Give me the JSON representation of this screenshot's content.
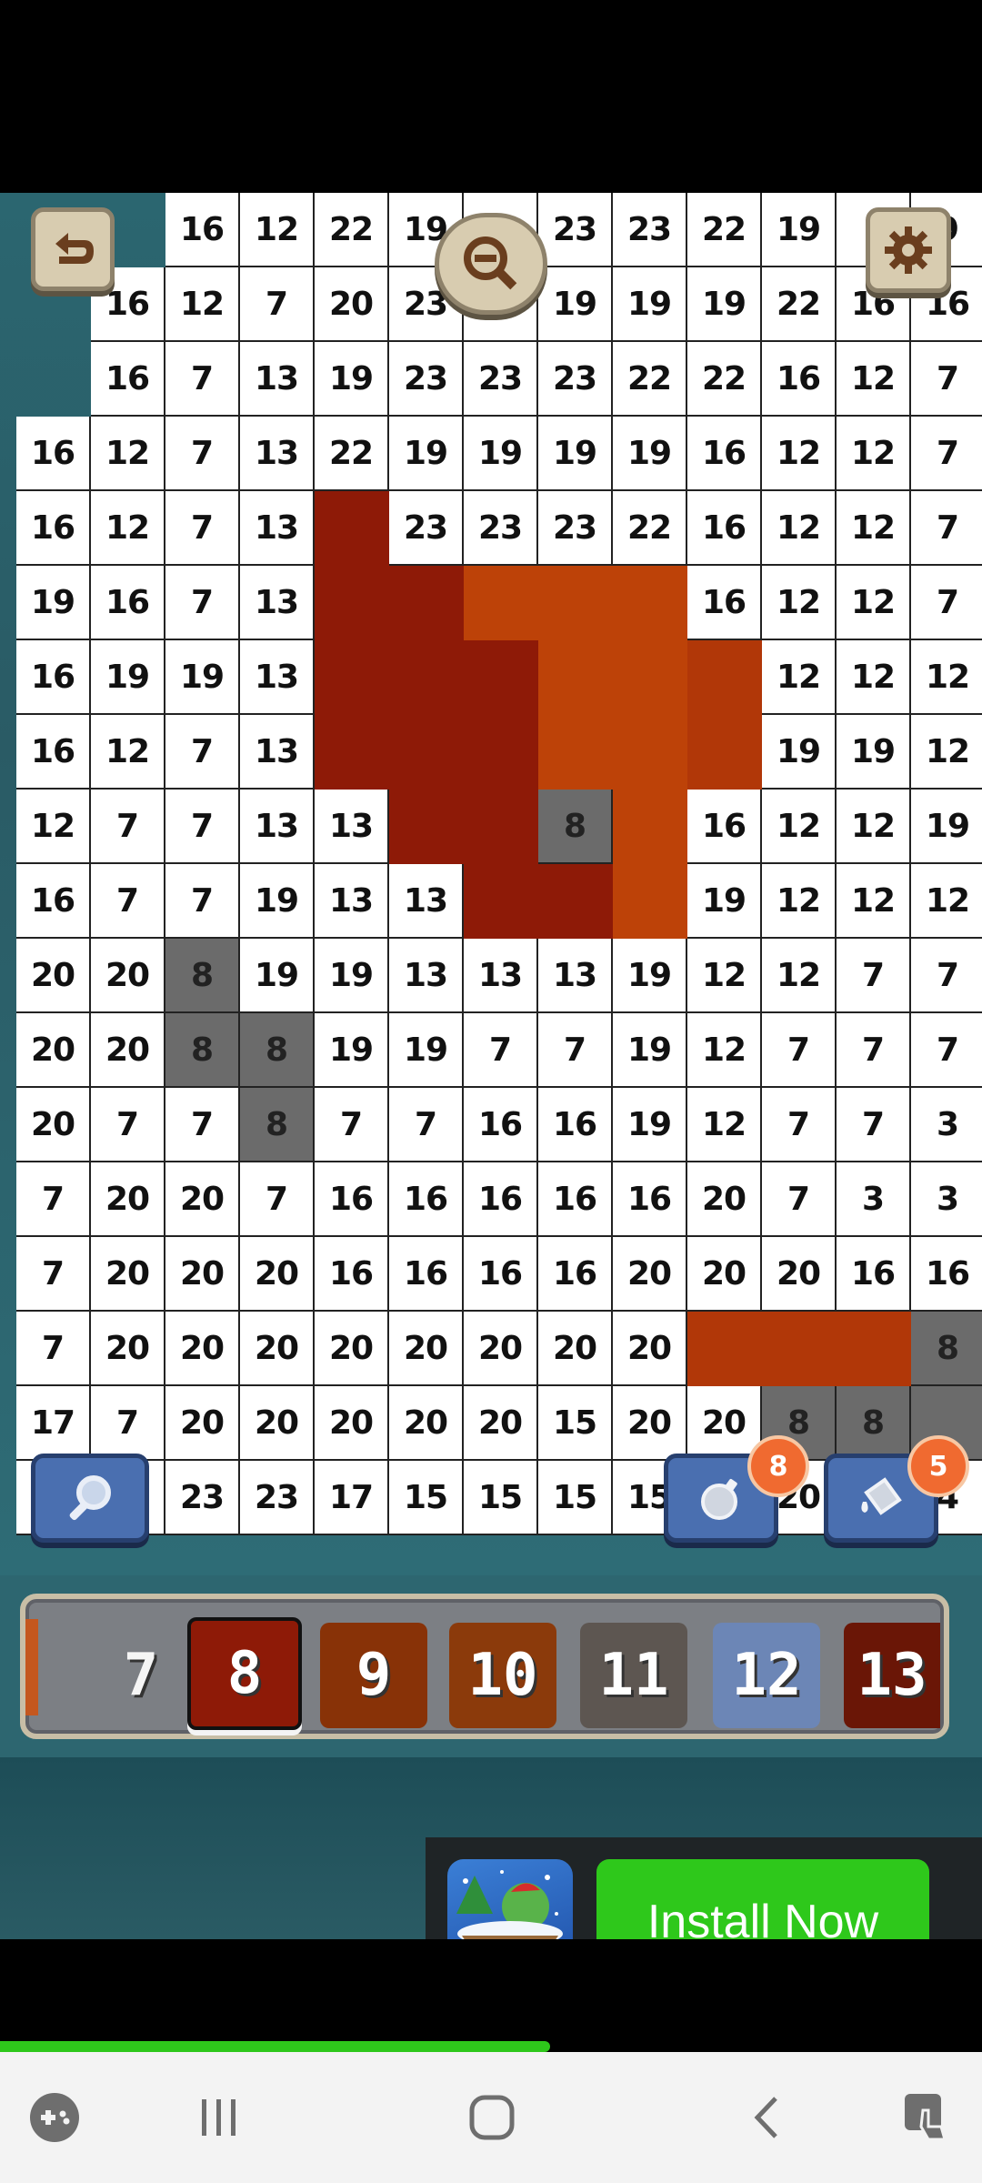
{
  "grid": {
    "rows": [
      [
        "",
        "",
        "16",
        "12",
        "22",
        "19",
        "",
        "23",
        "23",
        "22",
        "19",
        "",
        "9"
      ],
      [
        "",
        "16",
        "12",
        "7",
        "20",
        "23",
        "",
        "19",
        "19",
        "19",
        "22",
        "16",
        "16"
      ],
      [
        "",
        "16",
        "7",
        "13",
        "19",
        "23",
        "23",
        "23",
        "22",
        "22",
        "16",
        "12",
        "7"
      ],
      [
        "16",
        "12",
        "7",
        "13",
        "22",
        "19",
        "19",
        "19",
        "19",
        "16",
        "12",
        "12",
        "7"
      ],
      [
        "16",
        "12",
        "7",
        "13",
        "",
        "23",
        "23",
        "23",
        "22",
        "16",
        "12",
        "12",
        "7"
      ],
      [
        "19",
        "16",
        "7",
        "13",
        "",
        "",
        "",
        "",
        "",
        "16",
        "12",
        "12",
        "7"
      ],
      [
        "16",
        "19",
        "19",
        "13",
        "",
        "",
        "",
        "",
        "",
        "",
        "12",
        "12",
        "12"
      ],
      [
        "16",
        "12",
        "7",
        "13",
        "",
        "",
        "",
        "",
        "",
        "",
        "19",
        "19",
        "12"
      ],
      [
        "12",
        "7",
        "7",
        "13",
        "13",
        "",
        "",
        "8",
        "",
        "16",
        "12",
        "12",
        "19"
      ],
      [
        "16",
        "7",
        "7",
        "19",
        "13",
        "13",
        "",
        "",
        "",
        "19",
        "12",
        "12",
        "12"
      ],
      [
        "20",
        "20",
        "8",
        "19",
        "19",
        "13",
        "13",
        "13",
        "19",
        "12",
        "12",
        "7",
        "7"
      ],
      [
        "20",
        "20",
        "8",
        "8",
        "19",
        "19",
        "7",
        "7",
        "19",
        "12",
        "7",
        "7",
        "7"
      ],
      [
        "20",
        "7",
        "7",
        "8",
        "7",
        "7",
        "16",
        "16",
        "19",
        "12",
        "7",
        "7",
        "3"
      ],
      [
        "7",
        "20",
        "20",
        "7",
        "16",
        "16",
        "16",
        "16",
        "16",
        "20",
        "7",
        "3",
        "3"
      ],
      [
        "7",
        "20",
        "20",
        "20",
        "16",
        "16",
        "16",
        "16",
        "20",
        "20",
        "20",
        "16",
        "16"
      ],
      [
        "7",
        "20",
        "20",
        "20",
        "20",
        "20",
        "20",
        "20",
        "20",
        "",
        "",
        "",
        "8"
      ],
      [
        "17",
        "7",
        "20",
        "20",
        "20",
        "20",
        "20",
        "15",
        "20",
        "20",
        "8",
        "8",
        ""
      ],
      [
        "",
        "",
        "23",
        "23",
        "17",
        "15",
        "15",
        "15",
        "15",
        "",
        "20",
        "",
        "4"
      ]
    ],
    "fills": [
      [
        "bg",
        "bg",
        "w",
        "w",
        "w",
        "w",
        "w",
        "w",
        "w",
        "w",
        "w",
        "w",
        "w"
      ],
      [
        "bg",
        "w",
        "w",
        "w",
        "w",
        "w",
        "w",
        "w",
        "w",
        "w",
        "w",
        "w",
        "w"
      ],
      [
        "bg",
        "w",
        "w",
        "w",
        "w",
        "w",
        "w",
        "w",
        "w",
        "w",
        "w",
        "w",
        "w"
      ],
      [
        "w",
        "w",
        "w",
        "w",
        "w",
        "w",
        "w",
        "w",
        "w",
        "w",
        "w",
        "w",
        "w"
      ],
      [
        "w",
        "w",
        "w",
        "w",
        "c8",
        "w",
        "w",
        "w",
        "w",
        "w",
        "w",
        "w",
        "w"
      ],
      [
        "w",
        "w",
        "w",
        "w",
        "c8",
        "c8",
        "c10",
        "c10",
        "c10",
        "w",
        "w",
        "w",
        "w"
      ],
      [
        "w",
        "w",
        "w",
        "w",
        "c8",
        "c8",
        "c8",
        "c10",
        "c10",
        "c9",
        "w",
        "w",
        "w"
      ],
      [
        "w",
        "w",
        "w",
        "w",
        "c8",
        "c8",
        "c8",
        "c10",
        "c10",
        "c9",
        "w",
        "w",
        "w"
      ],
      [
        "w",
        "w",
        "w",
        "w",
        "w",
        "c8",
        "c8",
        "gray",
        "c10",
        "w",
        "w",
        "w",
        "w"
      ],
      [
        "w",
        "w",
        "w",
        "w",
        "w",
        "w",
        "c8",
        "c8",
        "c10",
        "w",
        "w",
        "w",
        "w"
      ],
      [
        "w",
        "w",
        "gray",
        "w",
        "w",
        "w",
        "w",
        "w",
        "w",
        "w",
        "w",
        "w",
        "w"
      ],
      [
        "w",
        "w",
        "gray",
        "gray",
        "w",
        "w",
        "w",
        "w",
        "w",
        "w",
        "w",
        "w",
        "w"
      ],
      [
        "w",
        "w",
        "w",
        "gray",
        "w",
        "w",
        "w",
        "w",
        "w",
        "w",
        "w",
        "w",
        "w"
      ],
      [
        "w",
        "w",
        "w",
        "w",
        "w",
        "w",
        "w",
        "w",
        "w",
        "w",
        "w",
        "w",
        "w"
      ],
      [
        "w",
        "w",
        "w",
        "w",
        "w",
        "w",
        "w",
        "w",
        "w",
        "w",
        "w",
        "w",
        "w"
      ],
      [
        "w",
        "w",
        "w",
        "w",
        "w",
        "w",
        "w",
        "w",
        "w",
        "c9",
        "c9",
        "c9",
        "gray"
      ],
      [
        "w",
        "w",
        "w",
        "w",
        "w",
        "w",
        "w",
        "w",
        "w",
        "w",
        "gray",
        "gray",
        "gray"
      ],
      [
        "w",
        "w",
        "w",
        "w",
        "w",
        "w",
        "w",
        "w",
        "w",
        "w",
        "w",
        "w",
        "w"
      ]
    ]
  },
  "badges": {
    "bomb_count": "8",
    "bucket_count": "5"
  },
  "palette": [
    {
      "label": "7",
      "color": "#7f7f7f"
    },
    {
      "label": "8",
      "color": "#8e1a07"
    },
    {
      "label": "9",
      "color": "#883207"
    },
    {
      "label": "10",
      "color": "#8b3a0b"
    },
    {
      "label": "11",
      "color": "#5d5651"
    },
    {
      "label": "12",
      "color": "#6c86b6"
    },
    {
      "label": "13",
      "color": "#6a1606"
    }
  ],
  "selected_color": "8",
  "ad": {
    "button_label": "Install Now"
  },
  "progress_fraction": 0.56
}
